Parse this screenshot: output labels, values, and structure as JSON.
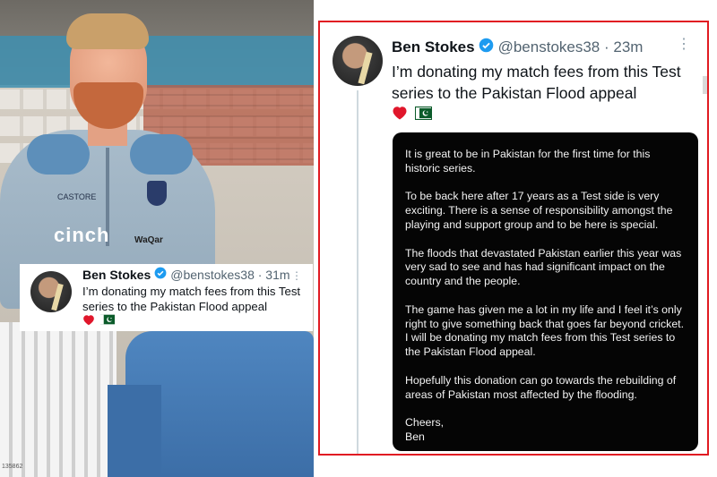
{
  "left_photo": {
    "sponsor_text": "cinch",
    "kit_brand": "CASTORE",
    "watermark": "WaQar",
    "photo_id": "135862"
  },
  "mini_tweet": {
    "name": "Ben Stokes",
    "handle": "@benstokes38 · 31m",
    "text": "I’m donating my match fees from this Test series to the Pakistan Flood appeal",
    "verified_icon": "verified-badge-icon",
    "emojis": [
      "heart-icon",
      "pakistan-flag-icon"
    ]
  },
  "tweet": {
    "name": "Ben Stokes",
    "handle": "@benstokes38 · 23m",
    "text": "I’m donating my match fees from this Test series to the Pakistan Flood appeal",
    "verified_icon": "verified-badge-icon",
    "menu_icon": "more-options-icon",
    "emojis": [
      "heart-icon",
      "pakistan-flag-icon"
    ],
    "accent_color": "#1d9bf0",
    "frame_color": "#e11b22"
  },
  "statement": {
    "paragraphs": [
      "It is great to be in Pakistan for the first time for this historic series.",
      "To be back here after 17 years as a Test side is very exciting. There is a sense of responsibility amongst the playing and support group and to be here is special.",
      "The floods that devastated Pakistan earlier this year was very sad to see and has had significant impact on the country and the people.",
      "The game has given me a lot in my life and I feel it’s only right to give something back that goes far beyond cricket. I will be donating my match fees from this Test series to the Pakistan Flood appeal.",
      "Hopefully this donation can go towards the rebuilding of areas of Pakistan most affected by the flooding."
    ],
    "signoff": "Cheers,",
    "signature": "Ben"
  }
}
